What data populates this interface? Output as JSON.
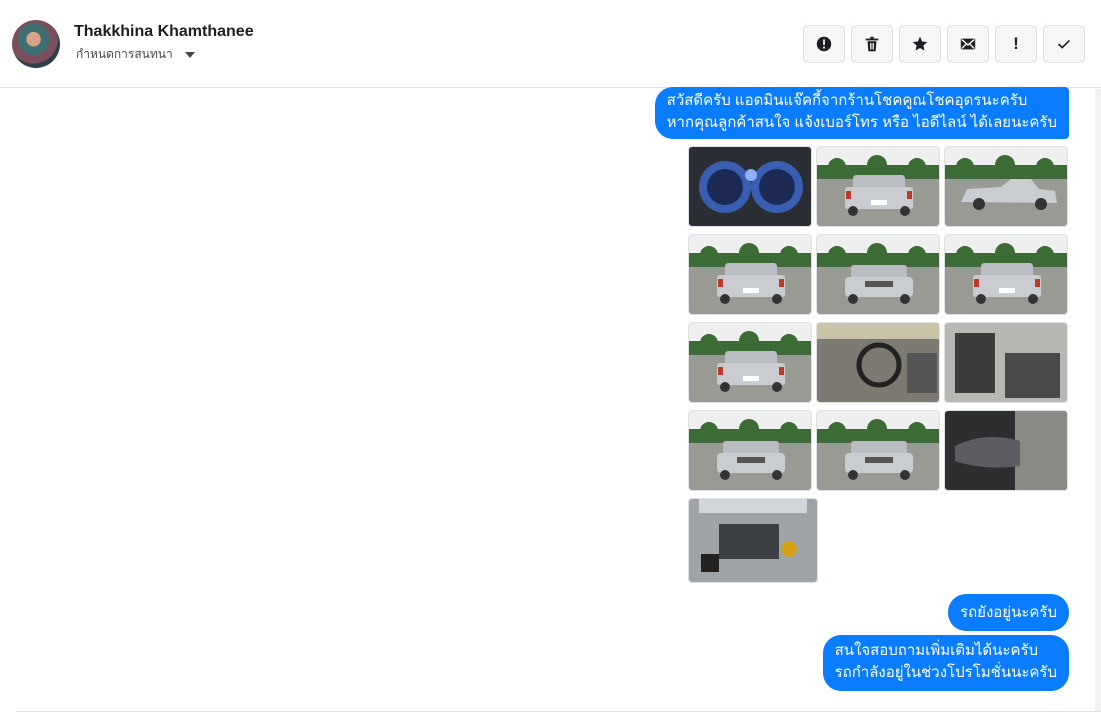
{
  "contact": {
    "name": "Thakkhina Khamthanee",
    "subtitle": "กำหนดการสนทนา"
  },
  "toolbar": {
    "buttons": [
      {
        "icon": "alert-circle-icon"
      },
      {
        "icon": "trash-icon"
      },
      {
        "icon": "star-icon"
      },
      {
        "icon": "mail-icon"
      },
      {
        "icon": "exclamation-icon",
        "label": "!"
      },
      {
        "icon": "check-icon"
      }
    ]
  },
  "messages": [
    {
      "line1": "สวัสดีครับ แอดมินแจ๊คกี้จากร้านโชคคูณโชคอุดรนะครับ",
      "line2": "หากคุณลูกค้าสนใจ แจ้งเบอร์โทร หรือ ไอดีไลน์ ได้เลยนะครับ"
    },
    {
      "text": "รถยังอยู่นะครับ"
    },
    {
      "line1": "สนใจสอบถามเพิ่มเติมได้นะครับ",
      "line2": "รถกำลังอยู่ในช่วงโปรโมชั่นนะครับ"
    }
  ],
  "photos": [
    {
      "subject": "dashboard"
    },
    {
      "subject": "pickup-rear-angle"
    },
    {
      "subject": "pickup-side"
    },
    {
      "subject": "pickup-rear"
    },
    {
      "subject": "pickup-front"
    },
    {
      "subject": "pickup-rear"
    },
    {
      "subject": "pickup-rear"
    },
    {
      "subject": "interior-steering"
    },
    {
      "subject": "interior-seat"
    },
    {
      "subject": "pickup-front-angle"
    },
    {
      "subject": "pickup-front"
    },
    {
      "subject": "door-panel"
    },
    {
      "subject": "engine-bay"
    }
  ],
  "colors": {
    "bubble": "#0a7cff",
    "car": "#c9ccd1",
    "sky": "#eef0ef",
    "trees": "#3d6b35",
    "ground": "#9a9a95"
  }
}
